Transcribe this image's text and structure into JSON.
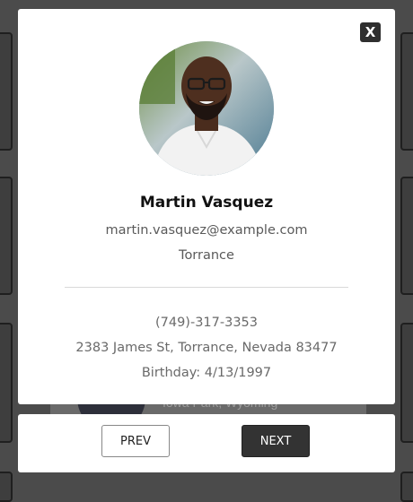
{
  "background": {
    "partial_text": "Iowa Park, Wyoming"
  },
  "modal": {
    "close_label": "X",
    "name": "Martin Vasquez",
    "email": "martin.vasquez@example.com",
    "city": "Torrance",
    "phone": "(749)-317-3353",
    "address": "2383 James St, Torrance, Nevada 83477",
    "birthday": "Birthday: 4/13/1997"
  },
  "footer": {
    "prev_label": "PREV",
    "next_label": "NEXT"
  },
  "colors": {
    "backdrop": "#4b4b4b",
    "modal_bg": "#ffffff",
    "next_button_bg": "#333333"
  }
}
